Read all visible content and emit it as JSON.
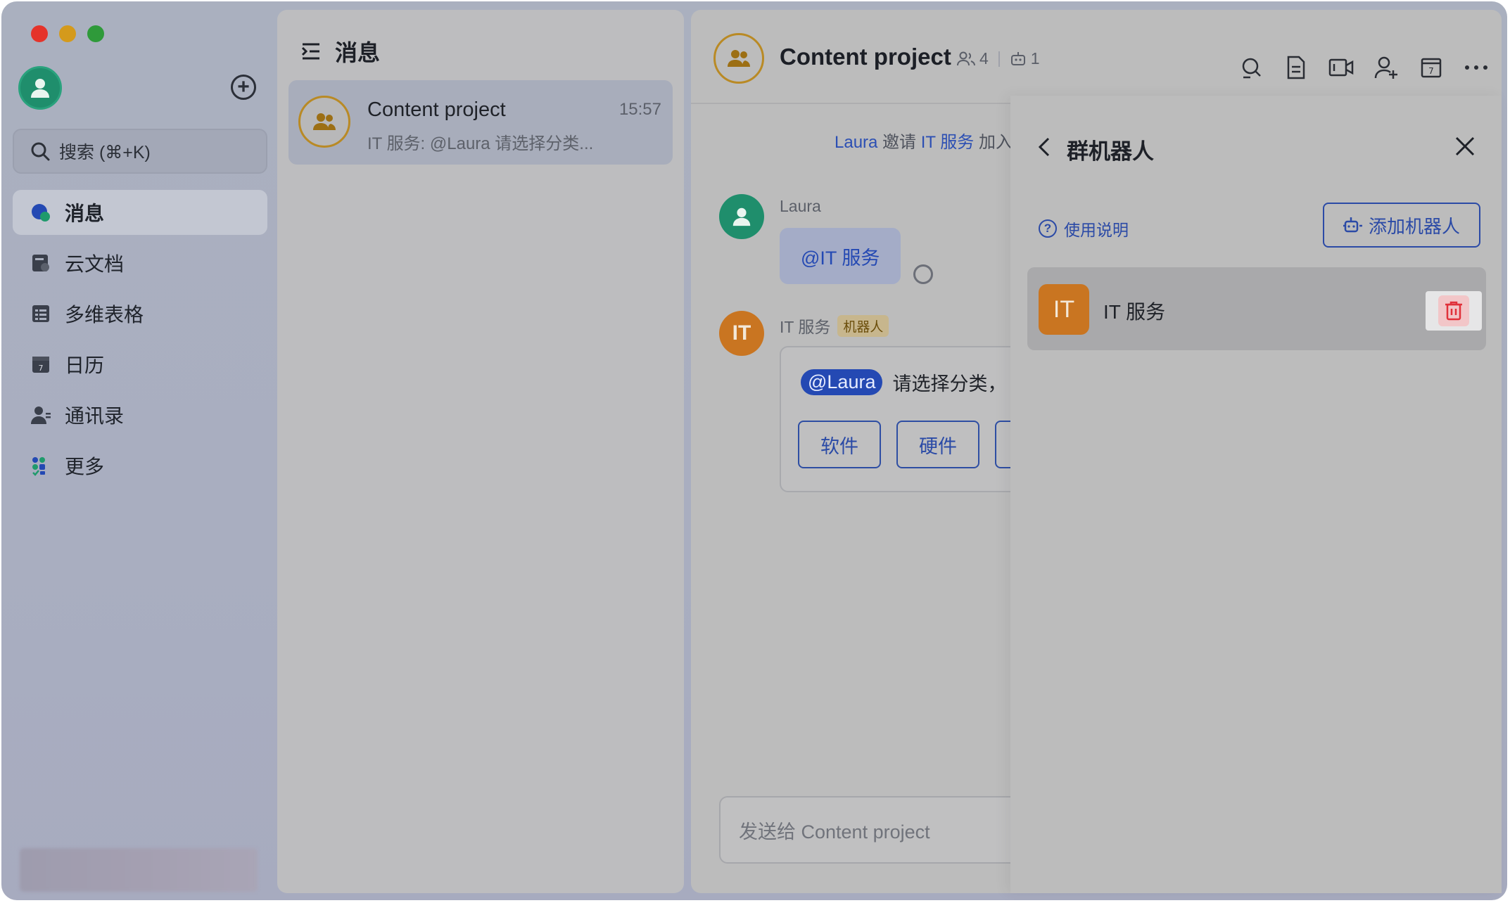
{
  "sidebar": {
    "search_placeholder": "搜索 (⌘+K)",
    "nav": [
      {
        "label": "消息",
        "icon": "message-bubble-icon",
        "active": true
      },
      {
        "label": "云文档",
        "icon": "cloud-doc-icon"
      },
      {
        "label": "多维表格",
        "icon": "base-table-icon"
      },
      {
        "label": "日历",
        "icon": "calendar-icon"
      },
      {
        "label": "通讯录",
        "icon": "contacts-icon"
      },
      {
        "label": "更多",
        "icon": "more-apps-icon"
      }
    ]
  },
  "message_list": {
    "title": "消息",
    "conversations": [
      {
        "title": "Content project",
        "time": "15:57",
        "preview": "IT 服务: @Laura 请选择分类..."
      }
    ]
  },
  "chat": {
    "title": "Content project",
    "member_count": "4",
    "bot_count": "1",
    "system_message": {
      "inviter": "Laura",
      "verb": " 邀请 ",
      "invitee": "IT 服务",
      "tail": " 加入"
    },
    "messages": [
      {
        "sender": "Laura",
        "text": "@IT 服务"
      },
      {
        "sender": "IT 服务",
        "tag": "机器人",
        "mention": "@Laura",
        "text": "请选择分类，",
        "options": [
          "软件",
          "硬件",
          ""
        ]
      }
    ],
    "input_placeholder": "发送给 Content project"
  },
  "bot_drawer": {
    "title": "群机器人",
    "help_label": "使用说明",
    "add_label": "添加机器人",
    "bots": [
      {
        "logo_text": "IT",
        "name": "IT 服务"
      }
    ]
  },
  "colors": {
    "accent": "#2b4aa6",
    "bot_orange": "#c97521",
    "avatar_green": "#1f8e6c",
    "danger": "#e0313a"
  }
}
